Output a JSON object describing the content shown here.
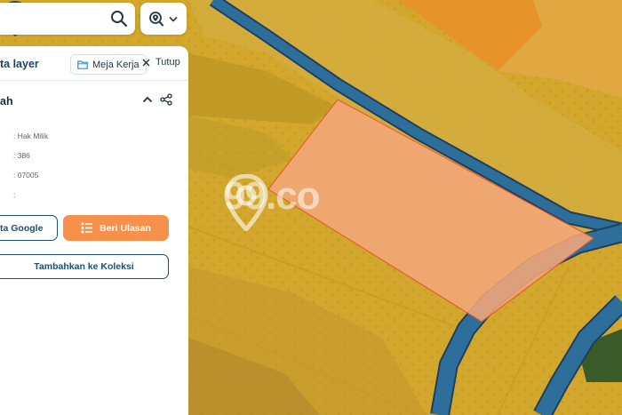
{
  "panel": {
    "title": "ta layer",
    "workspace_label": "Meja Kerja",
    "close_label": "Tutup",
    "section_title": "ah",
    "attributes": [
      ": Hak Milik",
      ": 386",
      ": 07005",
      ":"
    ],
    "google_button_label": "ta Google",
    "review_button_label": "Beri Ulasan",
    "collection_button_label": "Tambahkan ke Koleksi"
  },
  "map": {
    "watermark_text": "99.co",
    "parcel_color": "#f4a77a",
    "road_color": "#2b6c9a",
    "pin_color": "#1b4f72"
  },
  "icons": [
    "search-icon",
    "zoom-location-icon",
    "chevron-down-icon",
    "folder-icon",
    "close-icon",
    "chevron-up-icon",
    "share-icon",
    "list-icon",
    "map-pin-icon"
  ]
}
